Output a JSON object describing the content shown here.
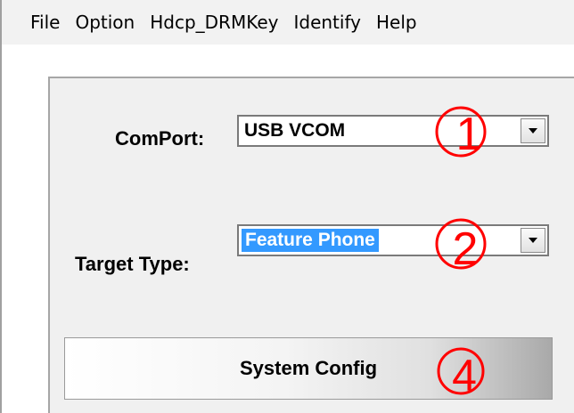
{
  "menu": {
    "items": [
      "File",
      "Option",
      "Hdcp_DRMKey",
      "Identify",
      "Help"
    ]
  },
  "comport": {
    "label": "ComPort:",
    "value": "USB VCOM"
  },
  "target_type": {
    "label": "Target Type:",
    "value": "Feature Phone"
  },
  "system_config": {
    "label": "System Config"
  },
  "annotations": {
    "marker_1": "1",
    "marker_2": "2",
    "marker_4": "4",
    "color": "#ff0000"
  },
  "colors": {
    "selection": "#3399ff",
    "menubar": "#f2f2f2",
    "panel": "#f0f0f0"
  }
}
